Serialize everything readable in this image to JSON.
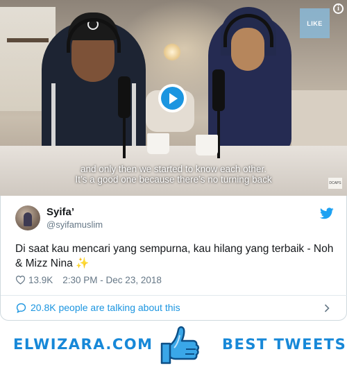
{
  "video": {
    "subtitle_line1": "and only then we started to know each other.",
    "subtitle_line2": "It’s a good one because there’s no turning back",
    "like_badge": "LIKE",
    "info_glyph": "i",
    "corner_watermark": "DCAPS"
  },
  "tweet": {
    "display_name": "Syifa’",
    "handle": "@syifamuslim",
    "text": "Di saat kau mencari yang sempurna, kau hilang yang terbaik - Noh & Mizz Nina ✨",
    "likes": "13.9K",
    "timestamp": "2:30 PM - Dec 23, 2018",
    "talking": "20.8K people are talking about this"
  },
  "banner": {
    "left_brand": "ELWIZARA.COM",
    "right_brand": "BEST TWEETS"
  },
  "colors": {
    "twitter_blue": "#1b95e0",
    "brand_blue": "#1788d8",
    "muted_gray": "#657786"
  },
  "icons": {
    "play": "play-icon",
    "info": "info-icon",
    "bird": "twitter-bird-icon",
    "heart": "heart-icon",
    "bubble": "speech-bubble-icon",
    "chevron": "chevron-right-icon",
    "thumb": "thumbs-up-icon"
  }
}
